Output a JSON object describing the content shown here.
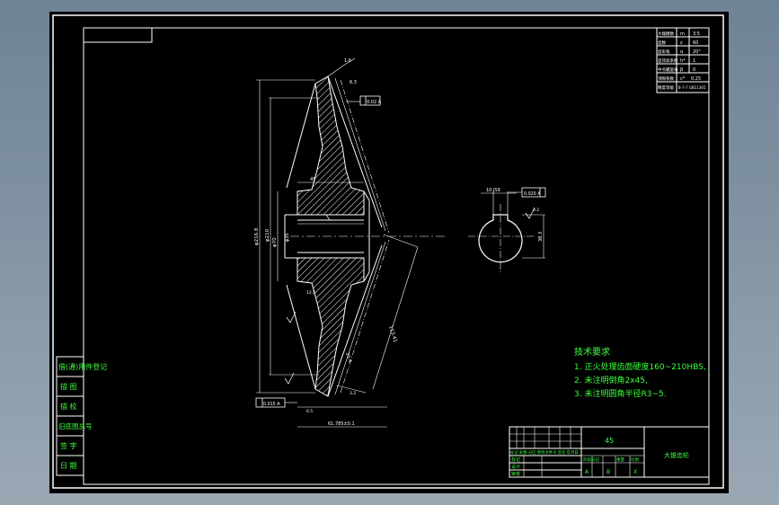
{
  "colors": {
    "background": "#000000",
    "frame": "#ffffff",
    "section": "#ffffff",
    "hatch": "#ffffff",
    "dimension": "#ffffff",
    "green_text": "#3cff3c",
    "window_bg": "#7f93a4"
  },
  "tech_requirements": {
    "title": "技术要求",
    "items": [
      "1. 正火处理齿面硬度160~210HBS,",
      "2. 未注明倒角2x45,",
      "3. 未注明圆角半径R3~5."
    ]
  },
  "left_strip": {
    "items": [
      "借(通)用件登记",
      "描 图",
      "描 校",
      "旧底图总号",
      "签 字",
      "日 期"
    ]
  },
  "title_block": {
    "material": "45",
    "part_name": "大锥齿轮",
    "row_labels": [
      "标记",
      "设计",
      "审核"
    ],
    "mid_row": "标记 处数 分区 更改文件号 签名 年月日",
    "weight_labels": [
      "阶段标记",
      "重量",
      "比例"
    ],
    "weight_values": [
      "A",
      "B",
      "X"
    ]
  },
  "params_table": {
    "rows": [
      [
        "大端模数",
        "m",
        "3.5"
      ],
      [
        "齿数",
        "z",
        "60"
      ],
      [
        "齿形角",
        "α",
        "20°"
      ],
      [
        "齿顶高系数",
        "h*",
        "1"
      ],
      [
        "中点螺旋角",
        "β",
        "0"
      ],
      [
        "顶隙系数",
        "c*",
        "0.25"
      ],
      [
        "精度等级",
        "",
        "8-7-7 GB11365"
      ]
    ]
  },
  "dimensions": {
    "overall_diameter": "φ216.8",
    "pitch_diameter": "φ210",
    "hub_diameter": "φ70",
    "bore": "φ35",
    "keyway_width": "10 JS9",
    "keyway_depth": "38.3",
    "tolerance_top": "0.02 A",
    "tolerance_keyway": "0.020 A",
    "tolerance_bottom": "0.015 A",
    "hub_length": "45",
    "width_bottom": "61.785±0.1",
    "width_small": "6.5",
    "slant_length": "113.41",
    "face_width": "20.4",
    "angle_top": "1.6",
    "roughness_top": "6.3",
    "roughness_hub": "12.5",
    "roughness_bore": "3.2",
    "roughness_side": "3.2"
  }
}
